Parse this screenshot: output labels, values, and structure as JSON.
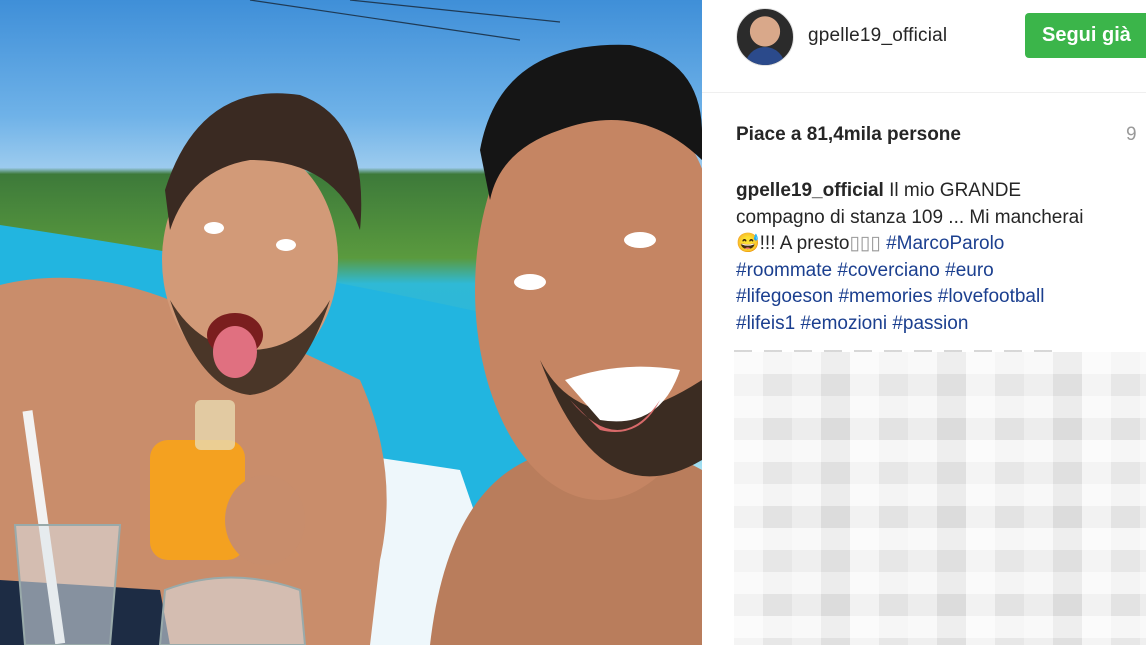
{
  "post": {
    "photo_alt": "Selfie by the pool",
    "username": "gpelle19_official",
    "follow_label": "Segui già",
    "likes_text": "Piace a 81,4mila persone",
    "likes_side": "9",
    "caption": {
      "user": "gpelle19_official",
      "text_line1": "Il mio GRANDE",
      "text_line2": "compagno di stanza 109 ... Mi mancherai",
      "text_line3_prefix": "😅!!! A presto",
      "emoji_boxes": "▯▯▯",
      "hashtags_line3": "#MarcoParolo",
      "hashtags_line4": [
        "#roommate",
        "#coverciano",
        "#euro"
      ],
      "hashtags_line5": [
        "#lifegoeson",
        "#memories",
        "#lovefootball"
      ],
      "hashtags_line6": [
        "#lifeis1",
        "#emozioni",
        "#passion"
      ]
    }
  },
  "colors": {
    "follow_green": "#3bb54a",
    "hashtag_blue": "#1b3f8f"
  }
}
